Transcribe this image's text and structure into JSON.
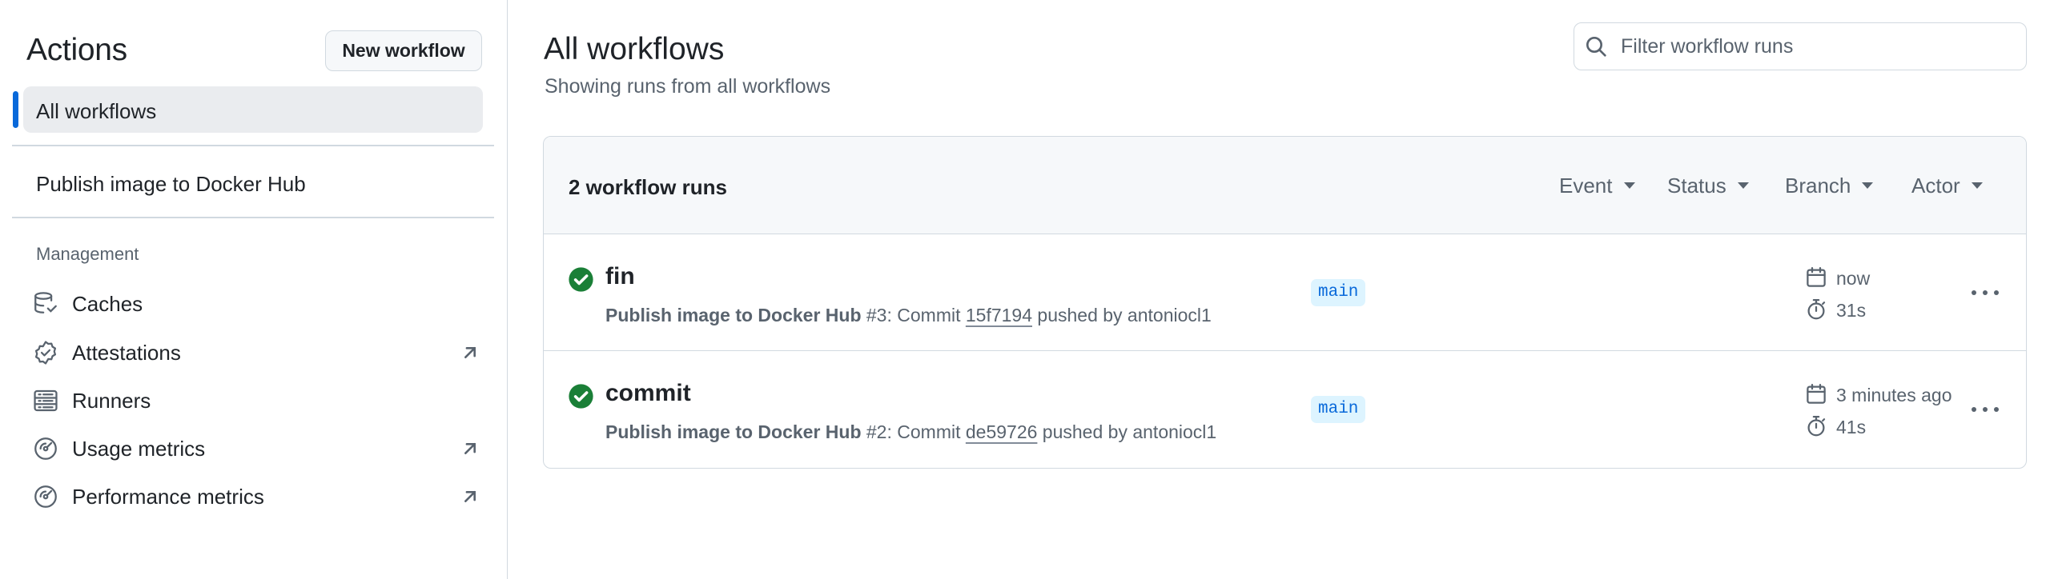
{
  "sidebar": {
    "title": "Actions",
    "new_workflow_label": "New workflow",
    "all_workflows_label": "All workflows",
    "workflows": [
      {
        "label": "Publish image to Docker Hub"
      }
    ],
    "management_heading": "Management",
    "management_items": [
      {
        "label": "Caches",
        "icon": "database-icon",
        "external": false
      },
      {
        "label": "Attestations",
        "icon": "verified-badge-icon",
        "external": true
      },
      {
        "label": "Runners",
        "icon": "server-icon",
        "external": false
      },
      {
        "label": "Usage metrics",
        "icon": "meter-icon",
        "external": true
      },
      {
        "label": "Performance metrics",
        "icon": "meter-icon",
        "external": true
      }
    ]
  },
  "main": {
    "title": "All workflows",
    "subtitle": "Showing runs from all workflows",
    "search": {
      "placeholder": "Filter workflow runs",
      "value": ""
    },
    "runs_count_label": "2 workflow runs",
    "filters": [
      "Event",
      "Status",
      "Branch",
      "Actor"
    ],
    "runs": [
      {
        "title": "fin",
        "status": "success",
        "workflow": "Publish image to Docker Hub",
        "run_prefix": " #3: Commit ",
        "commit": "15f7194",
        "pushed_by": " pushed by antoniocl1",
        "branch": "main",
        "when": "now",
        "duration": "31s"
      },
      {
        "title": "commit",
        "status": "success",
        "workflow": "Publish image to Docker Hub",
        "run_prefix": " #2: Commit ",
        "commit": "de59726",
        "pushed_by": " pushed by antoniocl1",
        "branch": "main",
        "when": "3 minutes ago",
        "duration": "41s"
      }
    ]
  },
  "colors": {
    "accent": "#0969da",
    "success": "#1a7f37",
    "muted_text": "#59636e",
    "border": "#d1d9e0",
    "header_bg": "#f6f8fa",
    "branch_bg": "#ddf4ff"
  }
}
